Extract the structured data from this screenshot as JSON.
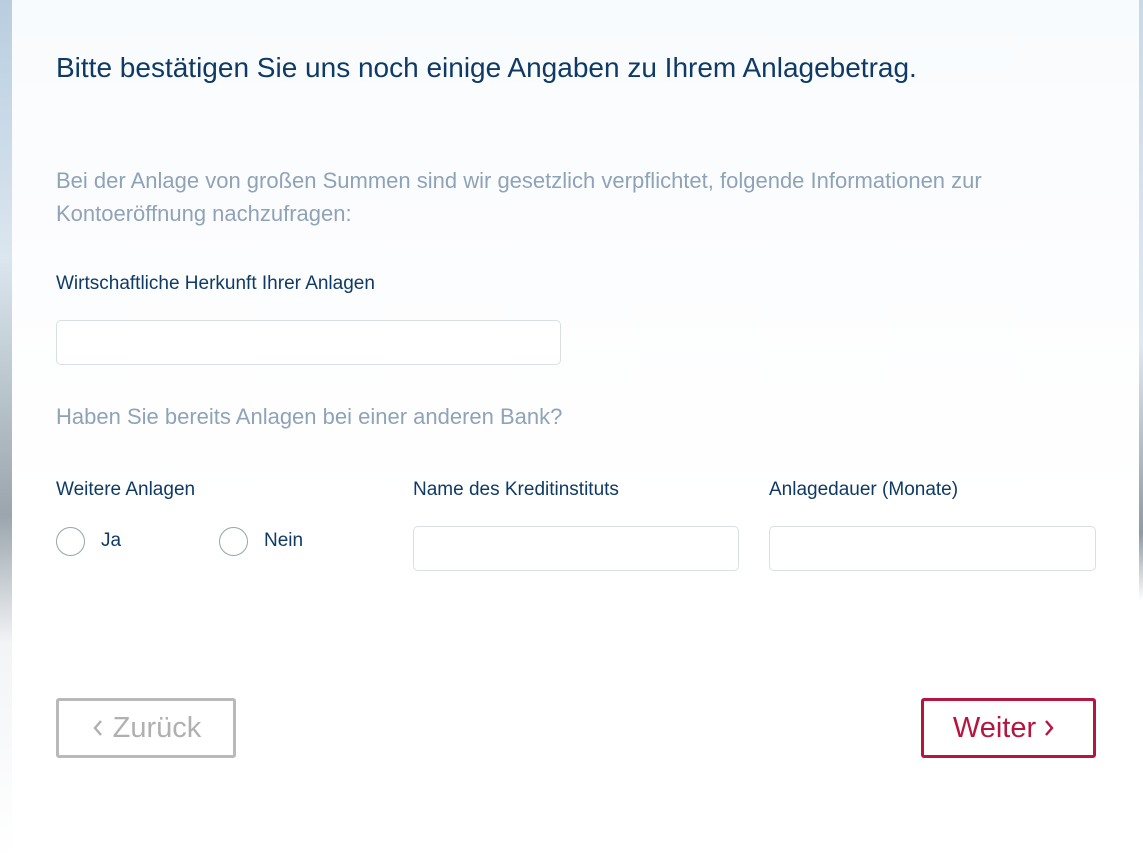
{
  "form": {
    "title": "Bitte bestätigen Sie uns noch einige Angaben zu Ihrem Anlagebetrag.",
    "intro": "Bei der Anlage von großen Summen sind wir gesetzlich verpflichtet, folgende Informationen zur Kontoeröffnung nachzufragen:",
    "origin_label": "Wirtschaftliche Herkunft Ihrer Anlagen",
    "origin_value": "",
    "other_banks_question": "Haben Sie bereits Anlagen bei einer anderen Bank?",
    "further_investments_label": "Weitere Anlagen",
    "radio_options": [
      "Ja",
      "Nein"
    ],
    "institution_label": "Name des Kreditinstituts",
    "institution_value": "",
    "duration_label": "Anlagedauer (Monate)",
    "duration_value": ""
  },
  "buttons": {
    "back_label": "Zurück",
    "next_label": "Weiter"
  },
  "colors": {
    "heading": "#0f3a66",
    "muted": "#8fa3b8",
    "accent": "#b5163f",
    "disabled": "#b9b9b9"
  },
  "icons": {
    "back": "chevron-left-icon",
    "next": "chevron-right-icon"
  }
}
